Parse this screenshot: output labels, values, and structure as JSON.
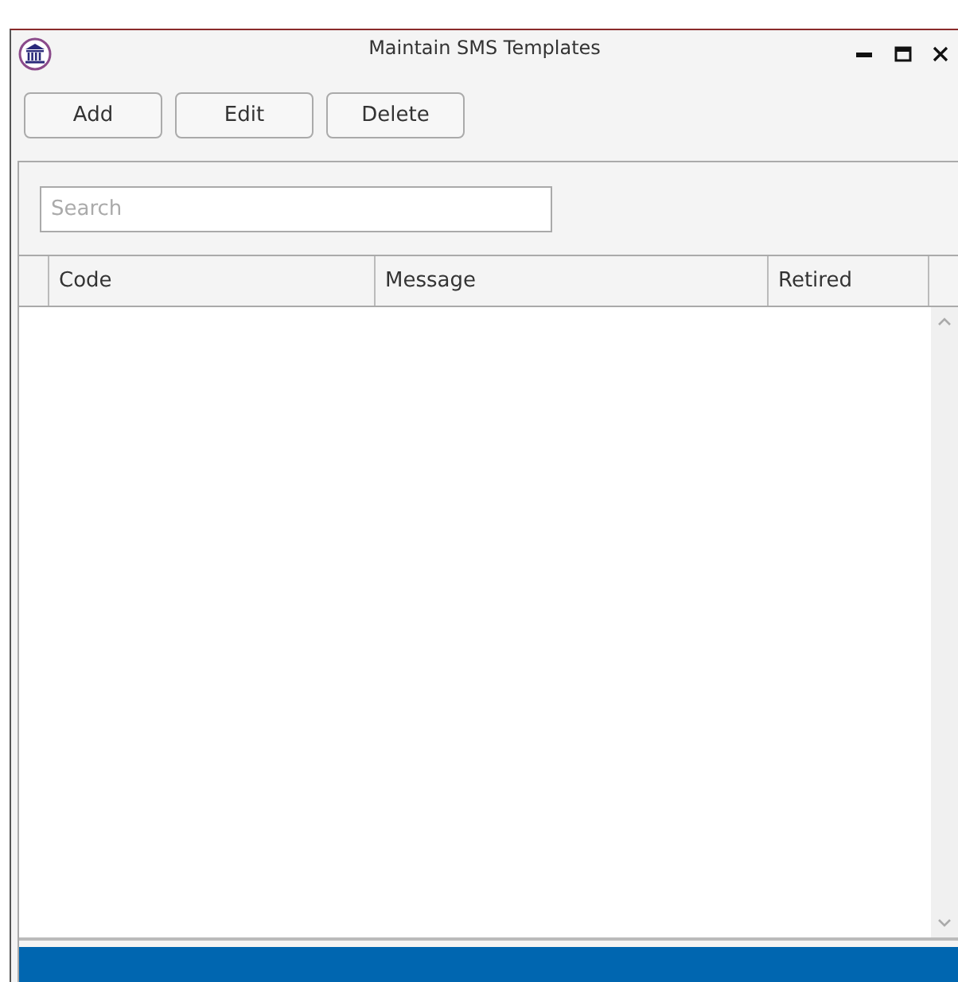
{
  "window": {
    "title": "Maintain SMS Templates"
  },
  "toolbar": {
    "buttons": [
      "Add",
      "Edit",
      "Delete"
    ]
  },
  "search": {
    "placeholder": "Search"
  },
  "table": {
    "columns": [
      "Code",
      "Message",
      "Retired"
    ]
  }
}
